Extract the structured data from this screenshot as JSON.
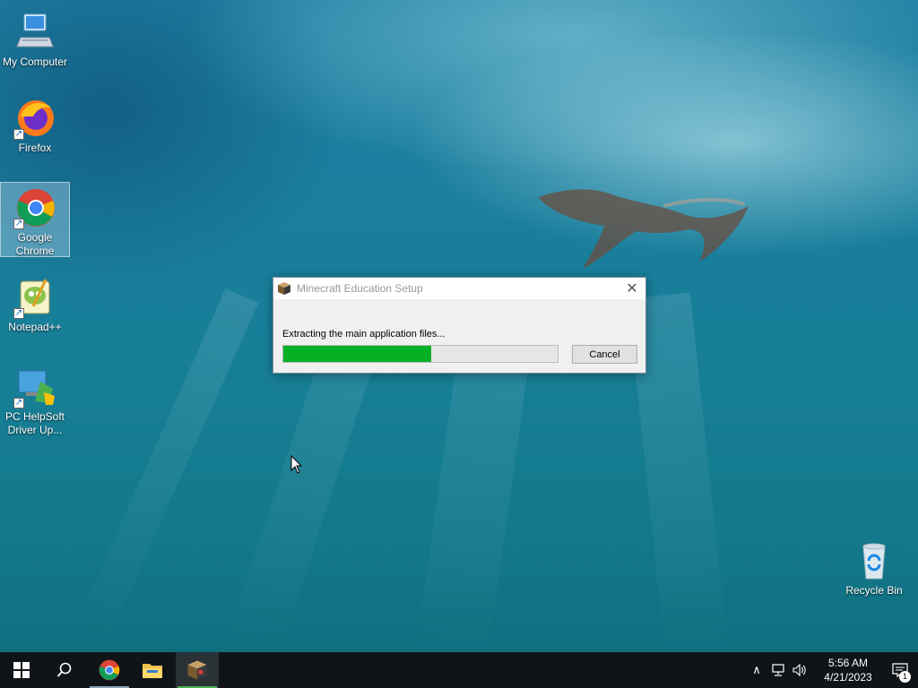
{
  "desktop": {
    "icons": [
      {
        "label": "My Computer"
      },
      {
        "label": "Firefox"
      },
      {
        "label": "Google Chrome"
      },
      {
        "label": "Notepad++"
      },
      {
        "label": "PC HelpSoft Driver Up..."
      },
      {
        "label": "Recycle Bin"
      }
    ]
  },
  "dialog": {
    "title": "Minecraft Education Setup",
    "message": "Extracting the main application files...",
    "progress_percent": 54,
    "cancel_label": "Cancel",
    "close_glyph": "✕"
  },
  "taskbar": {
    "pinned": [
      {
        "icon": "start-icon"
      },
      {
        "icon": "search-icon"
      },
      {
        "icon": "chrome-icon"
      },
      {
        "icon": "file-explorer-icon"
      },
      {
        "icon": "minecraft-setup-icon",
        "active": true
      }
    ],
    "tray": {
      "chevron": "∧",
      "time": "5:56 AM",
      "date": "4/21/2023",
      "notification_count": "1"
    }
  },
  "colors": {
    "progress_fill": "#06b025",
    "taskbar": "#101418",
    "active_underline": "#4caf50"
  }
}
